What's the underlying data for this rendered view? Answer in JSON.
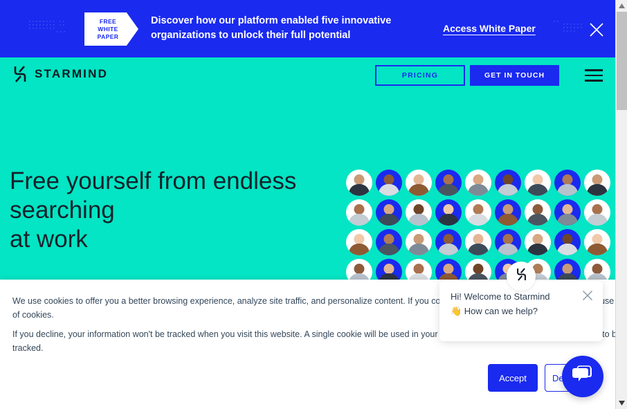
{
  "promo_banner": {
    "badge_lines": [
      "FREE",
      "WHITE",
      "PAPER"
    ],
    "headline": "Discover how our platform enabled five innovative organizations to unlock their full potential",
    "cta_label": "Access White Paper",
    "close_icon": "close-icon",
    "background_color": "#1A2AEF",
    "text_color": "#FFFFFF"
  },
  "navbar": {
    "logo_text": "STARMIND",
    "logo_icon": "starmind-logo-icon",
    "pricing_label": "PRICING",
    "get_in_touch_label": "GET IN TOUCH",
    "menu_icon": "hamburger-menu-icon",
    "background_color": "#03E5C4",
    "accent_color": "#1A2AEF"
  },
  "hero": {
    "title_lines": [
      "Free yourself from endless",
      "searching",
      "at work"
    ],
    "subtitle": "",
    "background_color": "#03E5C4",
    "avatar_grid": {
      "columns": 9,
      "rows": 5,
      "white_bg": "#FFFFFF",
      "blue_bg": "#1A2AEF",
      "pattern": [
        [
          "w",
          "b",
          "w",
          "b",
          "w",
          "b",
          "w",
          "b",
          "w"
        ],
        [
          "w",
          "b",
          "w",
          "b",
          "w",
          "b",
          "w",
          "b",
          "w"
        ],
        [
          "w",
          "b",
          "w",
          "b",
          "w",
          "b",
          "w",
          "b",
          "w"
        ],
        [
          "w",
          "b",
          "w",
          "b",
          "w",
          "b",
          "w",
          "b",
          "w"
        ],
        [
          "w",
          "b",
          "w",
          "b",
          "w",
          "b",
          "w",
          "b",
          "w"
        ]
      ]
    }
  },
  "cookie_banner": {
    "paragraph_1": "We use cookies to offer you a better browsing experience, analyze site traffic, and personalize content. If you continue to use this site, you consent to our use of cookies.",
    "paragraph_2": "If you decline, your information won't be tracked when you visit this website. A single cookie will be used in your browser to remember your preference not to be tracked.",
    "accept_label": "Accept",
    "decline_label": "Decline"
  },
  "chat_widget": {
    "greeting_line_1": "Hi! Welcome to Starmind",
    "greeting_line_2": "👋 How can we help?",
    "avatar_icon": "starmind-logo-icon",
    "close_icon": "close-icon",
    "launcher_icon": "chat-bubble-icon",
    "launcher_color": "#1A2AEF"
  },
  "scrollbar": {
    "up_icon": "scroll-up-arrow-icon",
    "down_icon": "scroll-down-arrow-icon",
    "thumb_position_percent": 3
  }
}
